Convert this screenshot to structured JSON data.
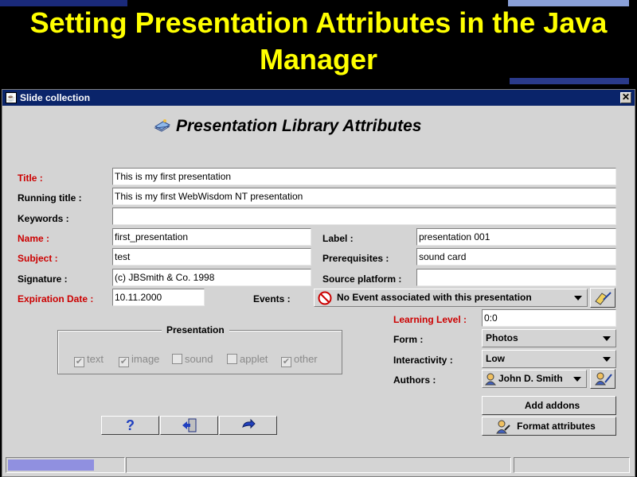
{
  "slide_title": "Setting Presentation Attributes in the Java Manager",
  "window": {
    "title": "Slide collection",
    "close_glyph": "✕"
  },
  "heading": "Presentation Library Attributes",
  "labels": {
    "title": "Title :",
    "running_title": "Running title :",
    "keywords": "Keywords :",
    "name": "Name :",
    "subject": "Subject :",
    "signature": "Signature :",
    "expiration_date": "Expiration Date :",
    "label": "Label :",
    "prerequisites": "Prerequisites :",
    "source_platform": "Source platform :",
    "events": "Events :",
    "learning_level": "Learning Level :",
    "form": "Form :",
    "interactivity": "Interactivity :",
    "authors": "Authors :"
  },
  "values": {
    "title": "This is my first presentation",
    "running_title": "This is my first WebWisdom NT presentation",
    "keywords": "",
    "name": "first_presentation",
    "subject": "test",
    "signature": "(c) JBSmith & Co. 1998",
    "expiration_date": "10.11.2000",
    "label": "presentation 001",
    "prerequisites": "sound card",
    "source_platform": "",
    "events": "No Event associated with this presentation",
    "learning_level": "0:0",
    "form": "Photos",
    "interactivity": "Low",
    "authors": "John D. Smith"
  },
  "presentation_group": {
    "legend": "Presentation",
    "options": [
      {
        "label": "text",
        "checked": true
      },
      {
        "label": "image",
        "checked": true
      },
      {
        "label": "sound",
        "checked": false
      },
      {
        "label": "applet",
        "checked": false
      },
      {
        "label": "other",
        "checked": true
      }
    ]
  },
  "buttons": {
    "add_addons": "Add addons",
    "format_attributes": "Format attributes",
    "help_glyph": "?"
  },
  "icons": {
    "help": "help-icon",
    "exit": "exit-door-icon",
    "next": "forward-arrow-icon",
    "event_edit": "edit-event-icon",
    "author_edit": "edit-author-icon"
  },
  "status": {
    "progress": 0.15
  },
  "colors": {
    "title_bar": "#0a246a",
    "slide_title": "#ffff00",
    "required_label": "#cc0000"
  }
}
